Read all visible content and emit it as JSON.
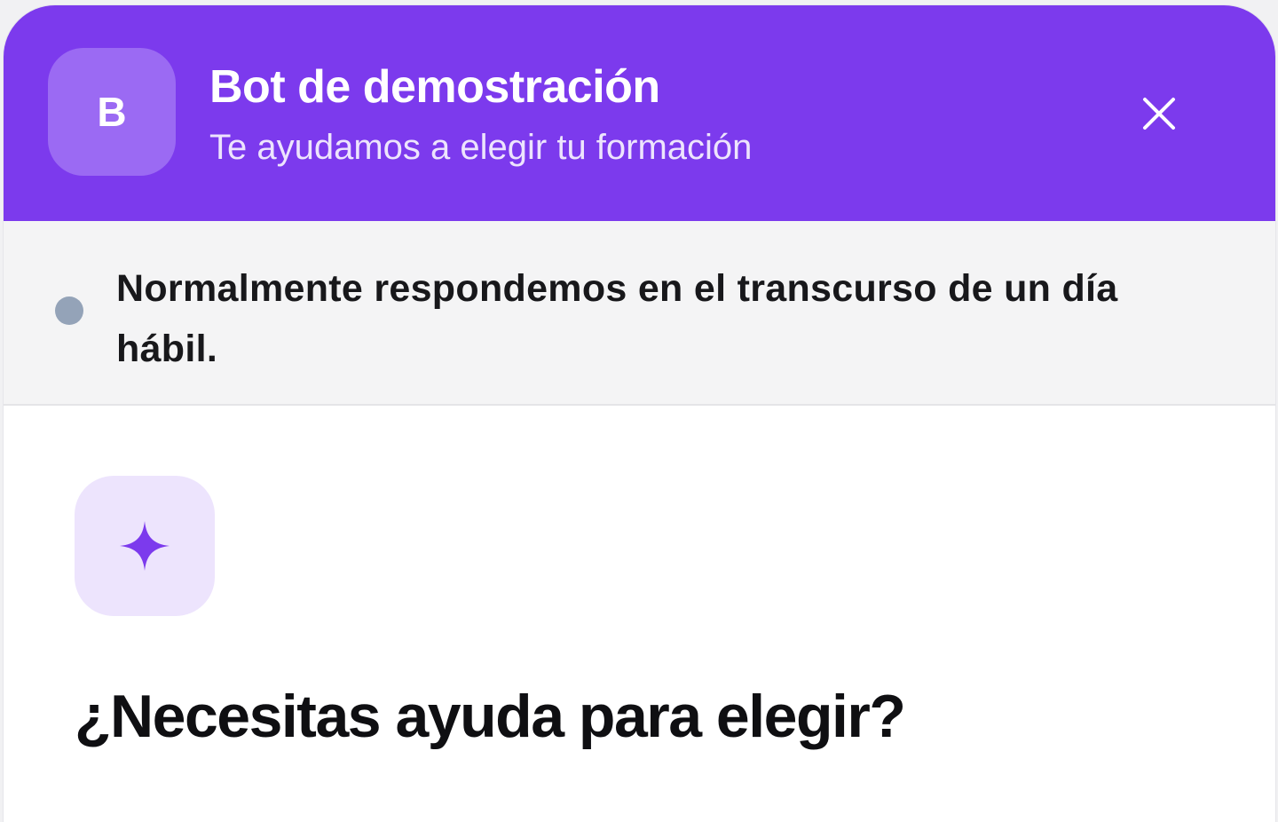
{
  "header": {
    "avatar_letter": "B",
    "title": "Bot de demostración",
    "subtitle": "Te ayudamos a elegir tu formación"
  },
  "status": {
    "text": "Normalmente respondemos en el transcurso de un día hábil."
  },
  "main": {
    "heading": "¿Necesitas ayuda para elegir?"
  },
  "colors": {
    "brand": "#7c3aed",
    "status_dot": "#94a3b8"
  }
}
